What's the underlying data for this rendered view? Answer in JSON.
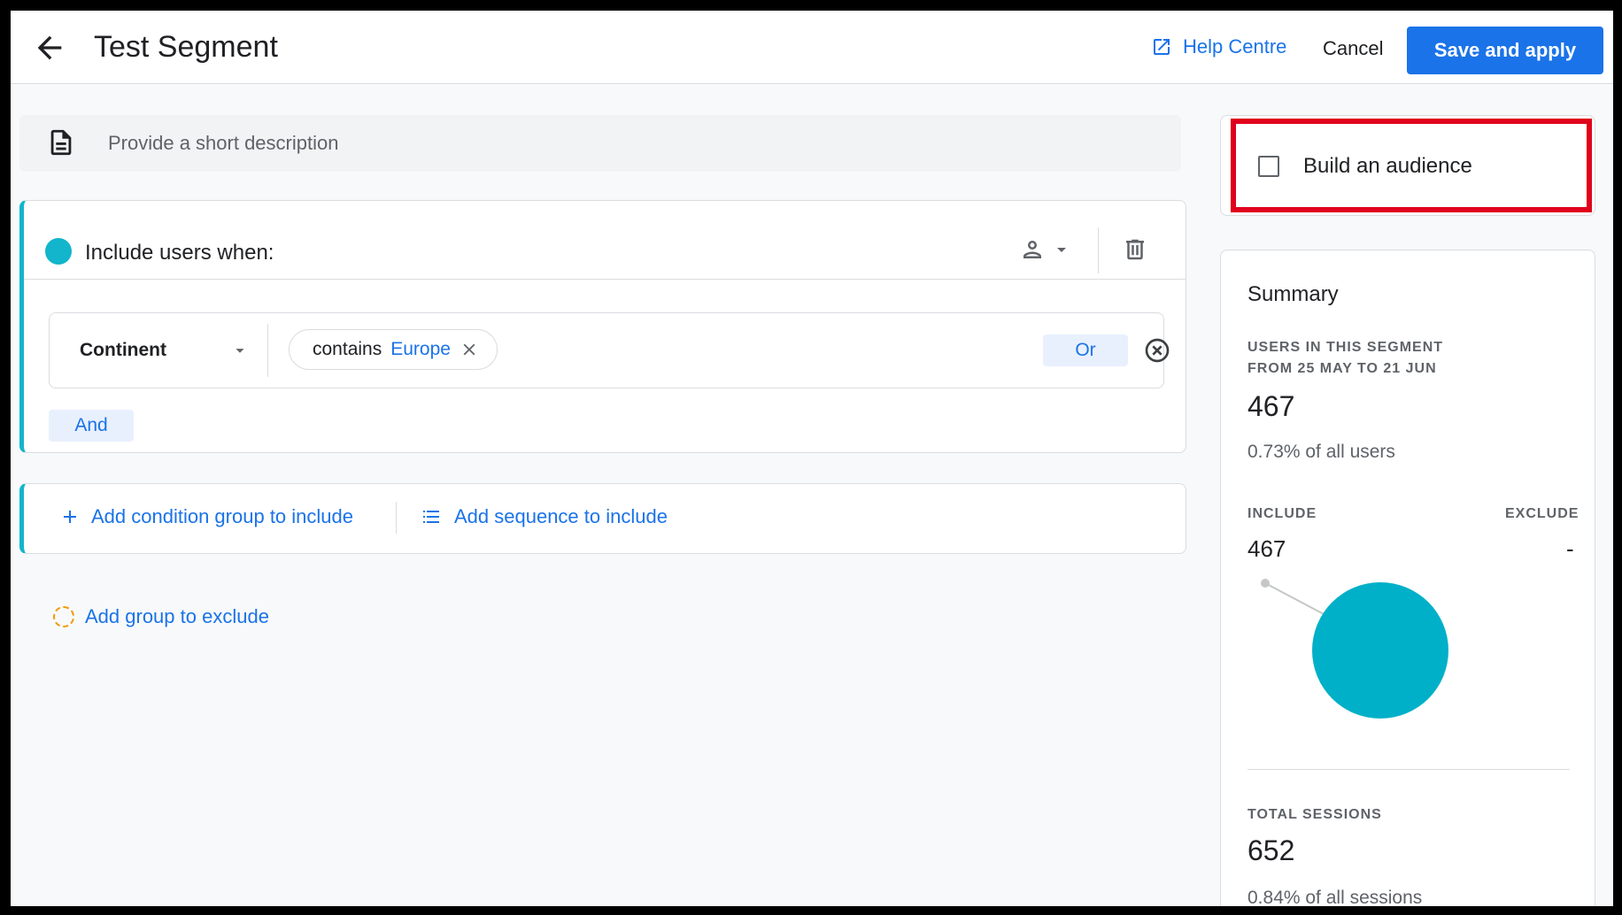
{
  "header": {
    "title": "Test Segment",
    "help_label": "Help Centre",
    "cancel_label": "Cancel",
    "save_label": "Save and apply"
  },
  "description": {
    "placeholder": "Provide a short description"
  },
  "include_group": {
    "label": "Include users when:",
    "dimension": "Continent",
    "operator": "contains",
    "value": "Europe",
    "or_label": "Or",
    "and_label": "And"
  },
  "actions": {
    "add_condition_group": "Add condition group to include",
    "add_sequence": "Add sequence to include",
    "add_exclude": "Add group to exclude"
  },
  "audience": {
    "label": "Build an audience",
    "checked": false
  },
  "summary": {
    "title": "Summary",
    "users_caption_1": "USERS IN THIS SEGMENT",
    "users_caption_2": "FROM 25 MAY TO 21 JUN",
    "users_count": "467",
    "users_pct": "0.73% of all users",
    "include_caption": "INCLUDE",
    "exclude_caption": "EXCLUDE",
    "include_value": "467",
    "exclude_value": "-",
    "sessions_caption": "TOTAL SESSIONS",
    "sessions_count": "652",
    "sessions_pct": "0.84% of all sessions"
  },
  "colors": {
    "accent": "#1a73e8",
    "teal": "#12b5cb",
    "pie_fill": "#00b0c8",
    "highlight": "#e0001b",
    "exclude_dash": "#f29900"
  },
  "icons": [
    "arrow-back-icon",
    "open-in-new-icon",
    "document-icon",
    "person-icon",
    "dropdown-arrow-icon",
    "delete-icon",
    "close-icon",
    "cancel-circle-icon",
    "add-icon",
    "list-icon"
  ]
}
